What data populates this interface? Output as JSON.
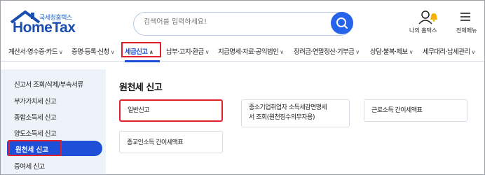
{
  "header": {
    "logo_sub": "국세청홈택스",
    "logo_main": "HomeTax",
    "search_placeholder": "검색어를 입력하세요!",
    "my_home_label": "나의 홈택스",
    "all_menu_label": "전체메뉴"
  },
  "nav": {
    "items": [
      {
        "label": "계산서·영수증·카드"
      },
      {
        "label": "증명·등록·신청"
      },
      {
        "label": "세금신고"
      },
      {
        "label": "납부·고지·환급"
      },
      {
        "label": "지급명세·자료·공익법인"
      },
      {
        "label": "장려금·연말정산·기부금"
      },
      {
        "label": "상담·불복·제보"
      },
      {
        "label": "세무대리·납세관리"
      }
    ],
    "active_index": 2
  },
  "sidebar": {
    "items": [
      {
        "label": "신고서 조회/삭제/부속서류"
      },
      {
        "label": "부가가치세 신고"
      },
      {
        "label": "종합소득세 신고"
      },
      {
        "label": "양도소득세 신고"
      },
      {
        "label": "원천세 신고"
      },
      {
        "label": "증여세 신고"
      }
    ],
    "active_index": 4
  },
  "main": {
    "title": "원천세 신고",
    "cards": [
      {
        "line1": "일반신고",
        "line2": ""
      },
      {
        "line1": "중소기업취업자 소득세감면명세",
        "line2": "서 조회(원천징수의무자용)"
      },
      {
        "line1": "근로소득 간이세액표",
        "line2": ""
      },
      {
        "line1": "종교인소득 간이세액표",
        "line2": ""
      }
    ]
  },
  "colors": {
    "brand_blue": "#1d4fd8",
    "highlight_red": "#e0202a",
    "sidebar_bg": "#eef2f9"
  }
}
